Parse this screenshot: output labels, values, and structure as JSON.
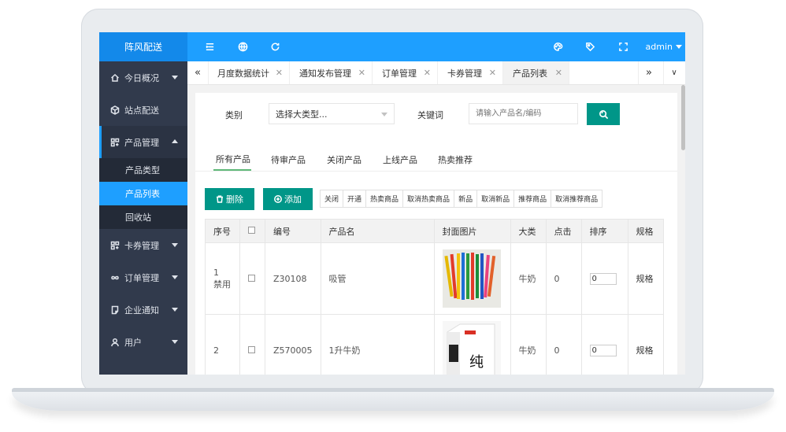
{
  "app": {
    "brand": "阵风配送",
    "user": "admin"
  },
  "toolbar_icons": [
    "menu-icon",
    "globe-icon",
    "refresh-icon",
    "palette-icon",
    "tag-icon",
    "fullscreen-icon"
  ],
  "sidebar": {
    "items": [
      {
        "label": "今日概况",
        "icon": "home-icon",
        "has_arrow": true
      },
      {
        "label": "站点配送",
        "icon": "cube-icon",
        "has_arrow": false
      },
      {
        "label": "产品管理",
        "icon": "apps-icon",
        "has_arrow": true,
        "open": true
      },
      {
        "label": "卡券管理",
        "icon": "apps-icon",
        "has_arrow": true
      },
      {
        "label": "订单管理",
        "icon": "infinity-icon",
        "has_arrow": true
      },
      {
        "label": "企业通知",
        "icon": "note-icon",
        "has_arrow": true
      },
      {
        "label": "用户",
        "icon": "user-icon",
        "has_arrow": true
      }
    ],
    "sub_items": [
      "产品类型",
      "产品列表",
      "回收站"
    ],
    "active_sub": "产品列表"
  },
  "tabs": [
    {
      "label": "月度数据统计"
    },
    {
      "label": "通知发布管理"
    },
    {
      "label": "订单管理"
    },
    {
      "label": "卡券管理"
    },
    {
      "label": "产品列表",
      "active": true
    }
  ],
  "filter": {
    "category_label": "类别",
    "category_value": "选择大类型...",
    "keyword_label": "关键词",
    "keyword_placeholder": "请输入产品名/编码"
  },
  "filter_tabs": [
    "所有产品",
    "待审产品",
    "关闭产品",
    "上线产品",
    "热卖推荐"
  ],
  "active_filter_tab": "所有产品",
  "actions": {
    "delete": "删除",
    "add": "添加"
  },
  "ops": [
    "关闭",
    "开通",
    "热卖商品",
    "取消热卖商品",
    "新品",
    "取消新品",
    "推荐商品",
    "取消推荐商品"
  ],
  "table": {
    "headers": [
      "序号",
      "",
      "编号",
      "产品名",
      "封面图片",
      "大类",
      "点击",
      "排序",
      "规格"
    ],
    "rows": [
      {
        "index": "1",
        "status": "禁用",
        "code": "Z30108",
        "name": "吸管",
        "category": "牛奶",
        "clicks": "0",
        "sort": "0",
        "spec": "规格"
      },
      {
        "index": "2",
        "status": "",
        "code": "Z570005",
        "name": "1升牛奶",
        "category": "牛奶",
        "clicks": "0",
        "sort": "0",
        "spec": "规格"
      }
    ]
  },
  "colors": {
    "topbar": "#1e9fff",
    "sidebar": "#313a4c",
    "accent": "#009688",
    "tab_underline": "#5fb878"
  }
}
